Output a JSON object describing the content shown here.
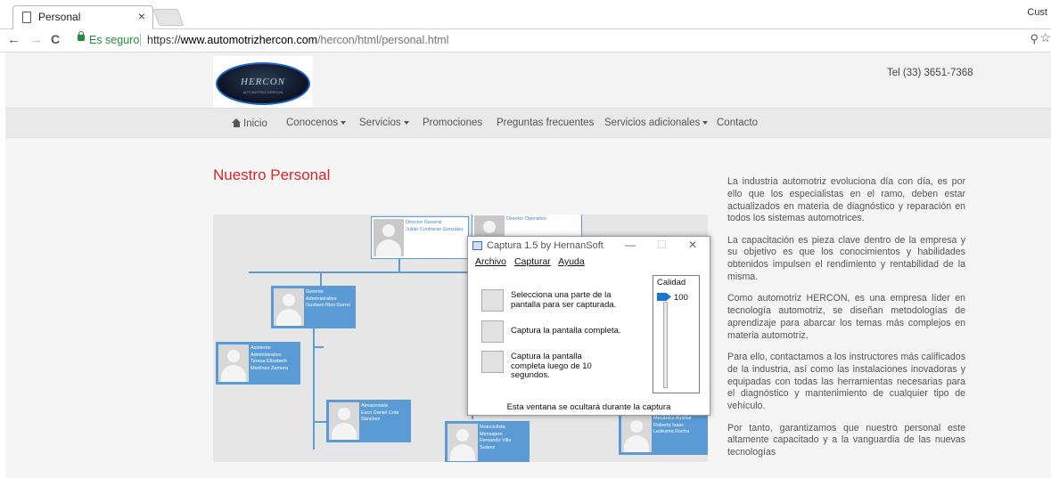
{
  "browser": {
    "tab_title": "Personal",
    "tab_close": "×",
    "user_label": "Cust",
    "back": "←",
    "forward": "→",
    "reload": "C",
    "secure_label": "Es seguro",
    "url_scheme": "https://",
    "url_domain": "www.automotrizhercon.com",
    "url_path": "/hercon/html/personal.html",
    "zoom": "⚲",
    "bookmark": "☆"
  },
  "site": {
    "logo_text": "HERCON",
    "logo_sub": "AUTOMOTRIZ HERCON",
    "phone": "Tel (33) 3651-7368",
    "nav": [
      {
        "label": "Inicio"
      },
      {
        "label": "Conocenos"
      },
      {
        "label": "Servicios"
      },
      {
        "label": "Promociones"
      },
      {
        "label": "Preguntas frecuentes"
      },
      {
        "label": "Servicios adicionales"
      },
      {
        "label": "Contacto"
      }
    ],
    "section_title": "Nuestro Personal",
    "org": [
      {
        "role": "Director General",
        "name": "Julián Contreras González"
      },
      {
        "role": "Director Operativo",
        "name": ""
      },
      {
        "role": "Gerente Administrativo",
        "name": "Gustavo Rizo Gurrel"
      },
      {
        "role": "Asistente Administrativo",
        "name": "Teresa Elizabeth Martínez Zamora"
      },
      {
        "role": "Almacenista",
        "name": "Esco Daniel Cota Sánchez"
      },
      {
        "role": "Motociclista Mensajero",
        "name": "Fernando Villa Suárez"
      },
      {
        "role": "Mecánico Auxiliar",
        "name": "Roberto Isaac Ledesma Rocha"
      }
    ],
    "paragraphs": [
      "La industria automotriz evoluciona día con día, es por ello que los especialistas en el ramo, deben estar actualizados en materia de diagnóstico y reparación en todos los sistemas automotrices.",
      "La capacitación es pieza clave dentro de la empresa y su objetivo es que los conocimientos y habilidades obtenidos impulsen el rendimiento y rentabilidad de la misma.",
      "Como automotriz HERCON, es una empresa líder en tecnología automotriz, se diseñan metodologías de aprendizaje para abarcar los temas más complejos en materia automotriz.",
      "Para ello, contactamos a los instructores más calificados de la industria, así como las instalaciones inovadoras y equipadas con todas las herramientas necesarias para el diagnóstico y mantenimiento de cualquier tipo de vehículo.",
      "Por tanto, garantizamos que nuestro personal este altamente capacitado y a la vanguardia de las nuevas tecnologías"
    ]
  },
  "capture": {
    "title": "Captura 1.5 by HernanSoft",
    "minimize": "—",
    "maximize": "☐",
    "close": "✕",
    "menu": [
      "Archivo",
      "Capturar",
      "Ayuda"
    ],
    "options": [
      "Selecciona una parte de la pantalla para ser capturada.",
      "Captura la pantalla completa.",
      "Captura la pantalla completa luego de 10 segundos."
    ],
    "quality_label": "Calidad",
    "quality_value": "100",
    "note": "Esta ventana se ocultará durante la captura"
  }
}
